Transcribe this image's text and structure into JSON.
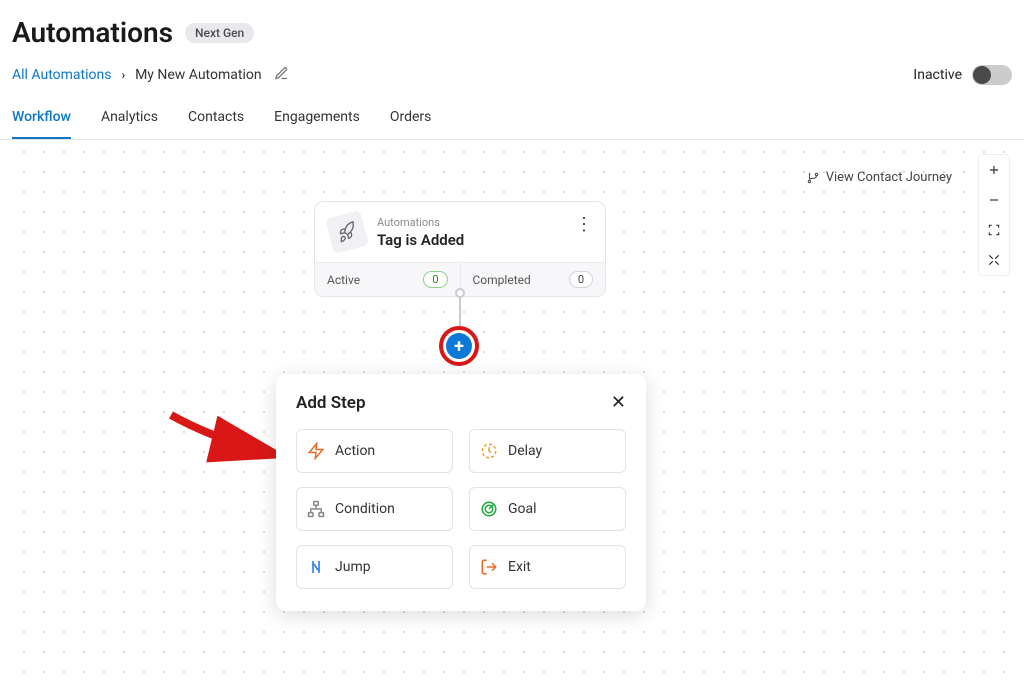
{
  "pageTitle": "Automations",
  "nextGenBadge": "Next Gen",
  "breadcrumb": {
    "root": "All Automations",
    "current": "My New Automation"
  },
  "status": {
    "label": "Inactive"
  },
  "tabs": [
    {
      "label": "Workflow",
      "active": true
    },
    {
      "label": "Analytics",
      "active": false
    },
    {
      "label": "Contacts",
      "active": false
    },
    {
      "label": "Engagements",
      "active": false
    },
    {
      "label": "Orders",
      "active": false
    }
  ],
  "viewJourneyLabel": "View Contact Journey",
  "triggerCard": {
    "overline": "Automations",
    "title": "Tag is Added",
    "stats": {
      "activeLabel": "Active",
      "activeCount": "0",
      "completedLabel": "Completed",
      "completedCount": "0"
    }
  },
  "popup": {
    "title": "Add Step",
    "steps": {
      "action": "Action",
      "delay": "Delay",
      "condition": "Condition",
      "goal": "Goal",
      "jump": "Jump",
      "exit": "Exit"
    }
  },
  "colors": {
    "accent": "#0c78c8",
    "highlightRed": "#d91717"
  }
}
